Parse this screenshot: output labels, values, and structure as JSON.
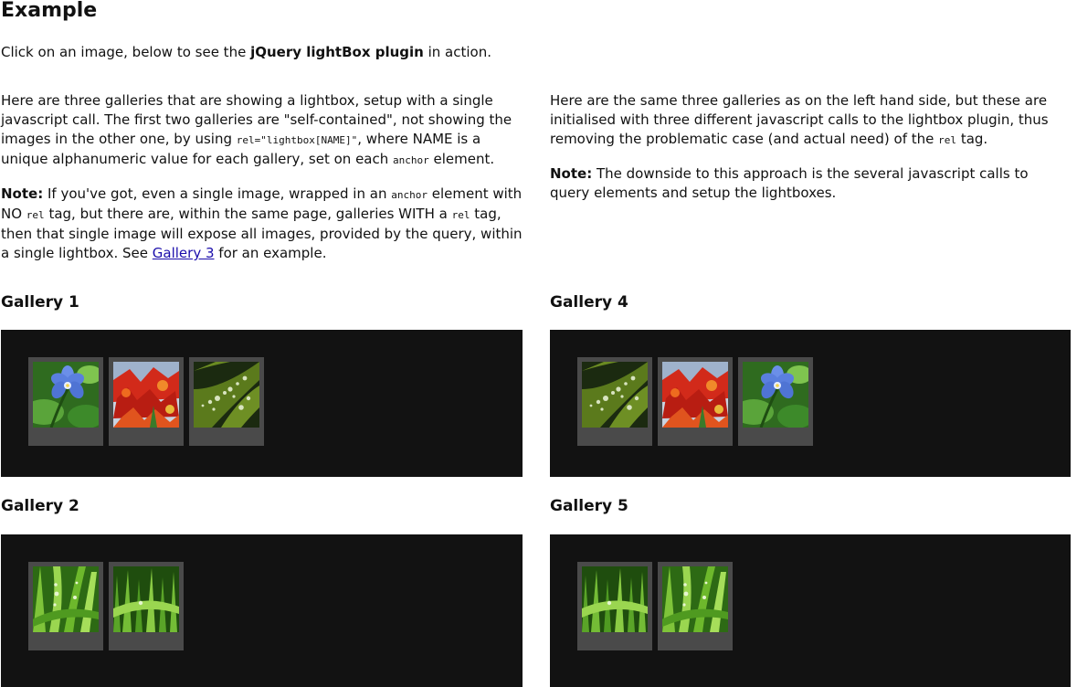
{
  "header": {
    "title": "Example"
  },
  "intro": {
    "before": "Click on an image, below to see the ",
    "strong": "jQuery lightBox plugin",
    "after": " in action."
  },
  "left_column": {
    "p1": {
      "t1": "Here are three galleries that are showing a lightbox, setup with a single javascript call. The first two galleries are \"self-contained\", not showing the images in the other one, by using ",
      "code1": "rel=\"lightbox[NAME]\"",
      "t2": ", where NAME is a unique alphanumeric value for each gallery, set on each ",
      "code2": "anchor",
      "t3": " element."
    },
    "p2": {
      "note": "Note:",
      "t1": " If you've got, even a single image, wrapped in an ",
      "code1": "anchor",
      "t2": " element with NO ",
      "code2": "rel",
      "t3": " tag, but there are, within the same page, galleries WITH a ",
      "code3": "rel",
      "t4": " tag, then that single image will expose all images, provided by the query, within a single lightbox. See ",
      "link": "Gallery 3",
      "t5": " for an example."
    }
  },
  "right_column": {
    "p1": {
      "t1": "Here are the same three galleries as on the left hand side, but these are initialised with three different javascript calls to the lightbox plugin, thus removing the problematic case (and actual need) of the ",
      "code1": "rel",
      "t2": " tag."
    },
    "p2": {
      "note": "Note:",
      "t1": " The downside to this approach is the several javascript calls to query elements and setup the lightboxes."
    }
  },
  "galleries": {
    "g1": {
      "title": "Gallery 1",
      "thumbs": [
        "blue-flower",
        "red-maple-leaves",
        "leaf-water-drops"
      ]
    },
    "g4": {
      "title": "Gallery 4",
      "thumbs": [
        "leaf-water-drops",
        "red-maple-leaves",
        "blue-flower"
      ]
    },
    "g2": {
      "title": "Gallery 2",
      "thumbs": [
        "green-grass-drops",
        "green-grass-blades"
      ]
    },
    "g5": {
      "title": "Gallery 5",
      "thumbs": [
        "green-grass-blades",
        "green-grass-drops"
      ]
    }
  },
  "colors": {
    "gallery_background": "#121212",
    "thumb_frame": "#4a4a4a",
    "link": "#1a0dab"
  }
}
